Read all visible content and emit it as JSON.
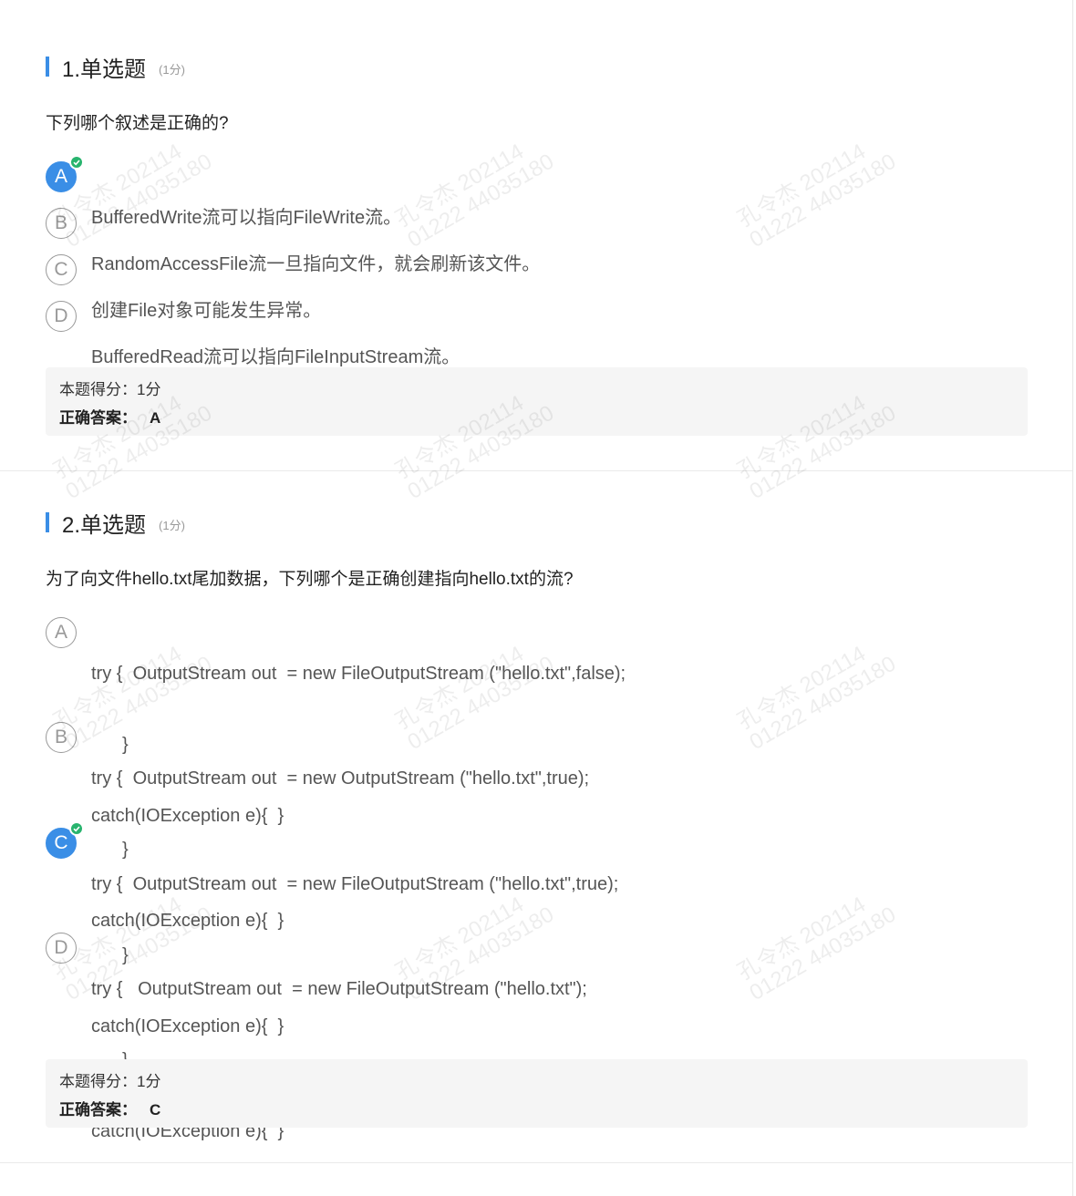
{
  "watermark": {
    "line1": "孔令杰 202114",
    "line2": "01222 44035180"
  },
  "questions": [
    {
      "title": "1.单选题",
      "points": "(1分)",
      "text": "下列哪个叙述是正确的?",
      "options": [
        {
          "letter": "A",
          "lines": [
            "BufferedWrite流可以指向FileWrite流。"
          ],
          "selected": true
        },
        {
          "letter": "B",
          "lines": [
            "RandomAccessFile流一旦指向文件，就会刷新该文件。"
          ],
          "selected": false
        },
        {
          "letter": "C",
          "lines": [
            "创建File对象可能发生异常。"
          ],
          "selected": false
        },
        {
          "letter": "D",
          "lines": [
            "BufferedRead流可以指向FileInputStream流。"
          ],
          "selected": false
        }
      ],
      "score_text": "本题得分：1分",
      "answer_label": "正确答案：",
      "answer": "A"
    },
    {
      "title": "2.单选题",
      "points": "(1分)",
      "text": "为了向文件hello.txt尾加数据，下列哪个是正确创建指向hello.txt的流?",
      "options": [
        {
          "letter": "A",
          "lines": [
            "try {  OutputStream out  = new FileOutputStream (\"hello.txt\",false);",
            "}",
            "catch(IOException e){  }"
          ],
          "selected": false
        },
        {
          "letter": "B",
          "lines": [
            "try {  OutputStream out  = new OutputStream (\"hello.txt\",true);",
            "}",
            "catch(IOException e){  }"
          ],
          "selected": false
        },
        {
          "letter": "C",
          "lines": [
            "try {  OutputStream out  = new FileOutputStream (\"hello.txt\",true);",
            "}",
            "catch(IOException e){  }"
          ],
          "selected": true
        },
        {
          "letter": "D",
          "lines": [
            "try {   OutputStream out  = new FileOutputStream (\"hello.txt\");",
            "}",
            "catch(IOException e){  }"
          ],
          "selected": false
        }
      ],
      "score_text": "本题得分：1分",
      "answer_label": "正确答案：",
      "answer": "C"
    }
  ]
}
